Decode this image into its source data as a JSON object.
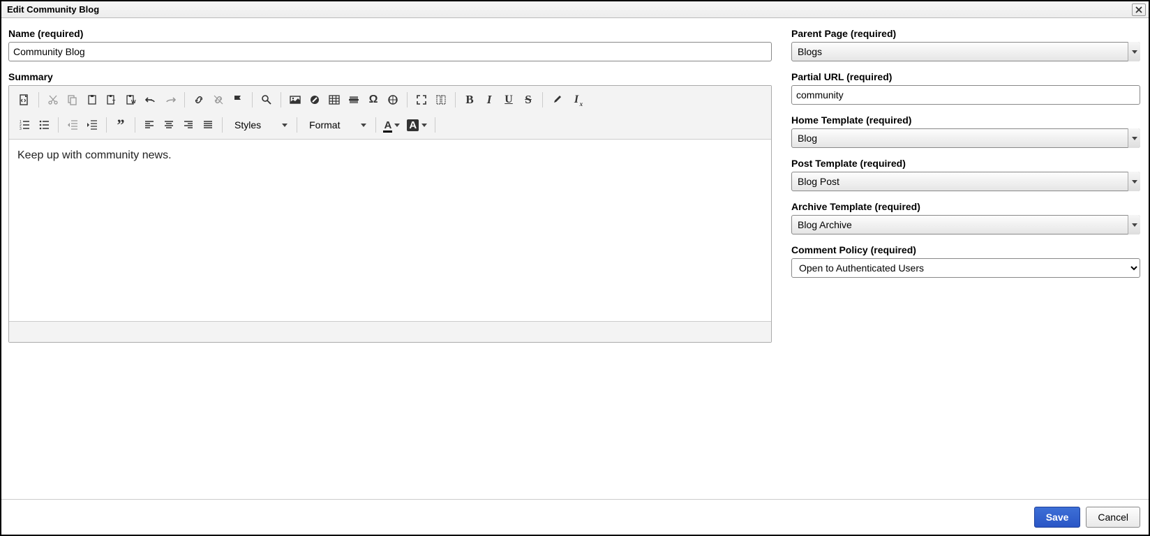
{
  "dialog": {
    "title": "Edit Community Blog"
  },
  "left": {
    "name_label": "Name (required)",
    "name_value": "Community Blog",
    "summary_label": "Summary",
    "summary_body": "Keep up with community news."
  },
  "toolbar": {
    "styles_combo": "Styles",
    "format_combo": "Format"
  },
  "right": {
    "parent_page_label": "Parent Page (required)",
    "parent_page_value": "Blogs",
    "partial_url_label": "Partial URL (required)",
    "partial_url_value": "community",
    "home_template_label": "Home Template (required)",
    "home_template_value": "Blog",
    "post_template_label": "Post Template (required)",
    "post_template_value": "Blog Post",
    "archive_template_label": "Archive Template (required)",
    "archive_template_value": "Blog Archive",
    "comment_policy_label": "Comment Policy (required)",
    "comment_policy_value": "Open to Authenticated Users"
  },
  "footer": {
    "save": "Save",
    "cancel": "Cancel"
  }
}
